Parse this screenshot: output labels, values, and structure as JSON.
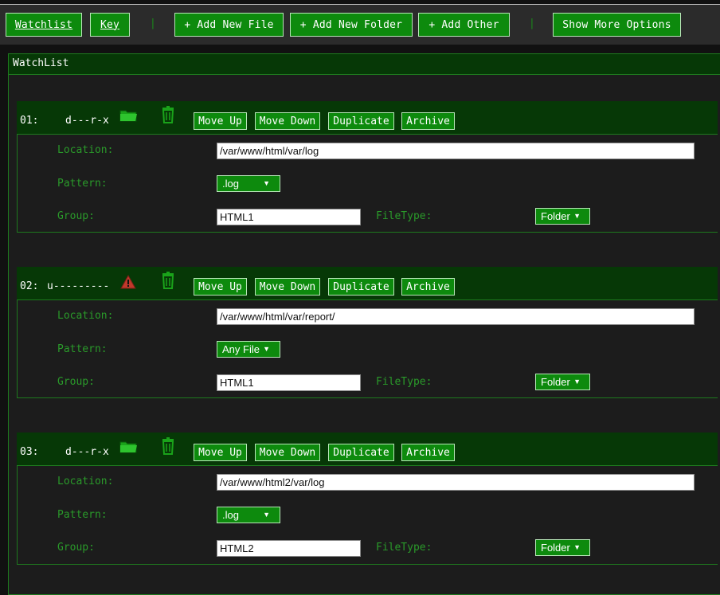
{
  "toolbar": {
    "watchlist": "Watchlist",
    "key": "Key",
    "sep": "|",
    "add_file": "+ Add New File",
    "add_folder": "+ Add New Folder",
    "add_other": "+ Add Other",
    "show_more": "Show More Options"
  },
  "panel": {
    "title": "WatchList"
  },
  "labels": {
    "location": "Location:",
    "pattern": "Pattern:",
    "group": "Group:",
    "filetype": "FileType:",
    "move_up": "Move Up",
    "move_down": "Move Down",
    "duplicate": "Duplicate",
    "archive": "Archive",
    "caret": "▼"
  },
  "entries": [
    {
      "num": "01:",
      "perms": "d---r-x",
      "status_icon": "folder-icon",
      "location": "/var/www/html/var/log",
      "pattern": ".log",
      "group": "HTML1",
      "filetype": "Folder"
    },
    {
      "num": "02:",
      "perms": "u---------",
      "status_icon": "warning-icon",
      "location": "/var/www/html/var/report/",
      "pattern": "Any File",
      "group": "HTML1",
      "filetype": "Folder"
    },
    {
      "num": "03:",
      "perms": "d---r-x",
      "status_icon": "folder-icon",
      "location": "/var/www/html2/var/log",
      "pattern": ".log",
      "group": "HTML2",
      "filetype": "Folder"
    }
  ],
  "colors": {
    "accent": "#0d8a0d",
    "header_bg": "#063806",
    "label": "#2a9a2a",
    "warning": "#c0392b"
  }
}
